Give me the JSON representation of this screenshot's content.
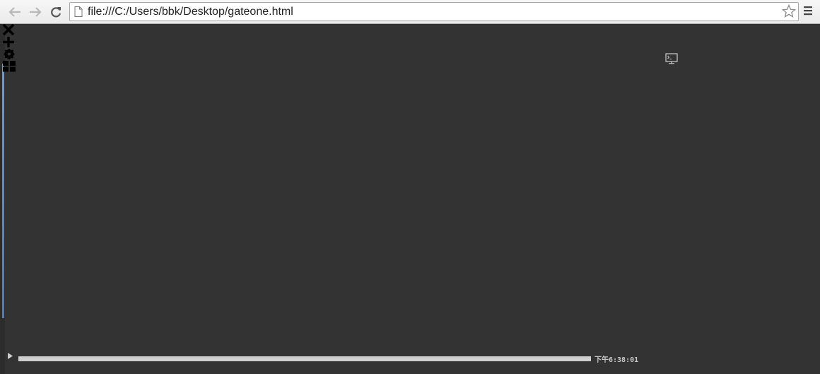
{
  "browser": {
    "address": "file:///C:/Users/bbk/Desktop/gateone.html",
    "icons": {
      "back": "arrow-left-icon",
      "forward": "arrow-right-icon",
      "reload": "reload-icon",
      "page": "document-icon",
      "bookmark": "star-icon",
      "menu": "hamburger-menu-icon"
    }
  },
  "gateone": {
    "toolbar_icons": [
      "close-icon",
      "plus-icon",
      "gear-icon",
      "grid-icon"
    ],
    "terminal_icon": "terminal-icon",
    "playback": {
      "play_icon": "play-icon",
      "progress_percent": 100,
      "clock": "下午6:38:01"
    },
    "colors": {
      "background": "#333333",
      "progress": "#cfcfcf",
      "accent": "#5a8cc4"
    }
  }
}
